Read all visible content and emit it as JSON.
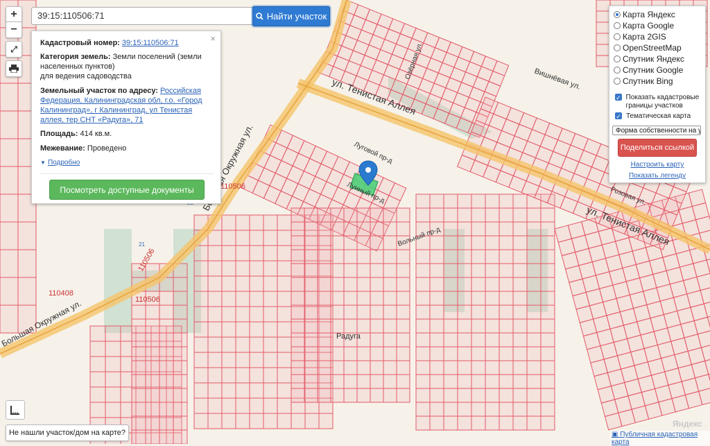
{
  "search": {
    "value": "39:15:110506:71",
    "button_label": "Найти участок"
  },
  "zoom": {
    "in": "+",
    "out": "−"
  },
  "info": {
    "cadastral_label": "Кадастровый номер:",
    "cadastral_value": "39:15:110506:71",
    "category_label": "Категория земель:",
    "category_value": "Земли поселений (земли населенных пунктов)",
    "category_use": "для ведения садоводства",
    "address_label": "Земельный участок по адресу:",
    "address_value": "Российская Федерация, Калининградская обл, г.о. «Город Калининград», г Калининград, ул Тенистая аллея, тер СНТ «Радуга», 71",
    "area_label": "Площадь:",
    "area_value": "414 кв.м.",
    "survey_label": "Межевание:",
    "survey_value": "Проведено",
    "details_link": "Подробно",
    "docs_button": "Посмотреть доступные документы",
    "close": "×"
  },
  "layers": {
    "options": [
      "Карта Яндекс",
      "Карта Google",
      "Карта 2GIS",
      "OpenStreetMap",
      "Спутник Яндекс",
      "Спутник Google",
      "Спутник Bing"
    ],
    "selected": "Карта Яндекс",
    "show_borders": "Показать кадастровые границы участков",
    "thematic": "Тематическая карта",
    "select_value": "Форма собственности на у",
    "share": "Поделиться ссылкой",
    "configure": "Настроить карту",
    "legend": "Показать легенду"
  },
  "bottom_button": "Не нашли участок/дом на карте?",
  "attribution": "Публичная кадастровая карта",
  "map_brand": "Яндекс",
  "map_labels": {
    "street_tenistaya": "ул. Тенистая Аллея",
    "street_tenistaya_2": "ул. Тенистая Аллея",
    "street_okruzhnaya": "Большая Окружная ул.",
    "street_okruzhnaya_2": "Большая Окружная ул.",
    "street_vishnevaya": "Вишнёвая ул.",
    "street_rozovaya": "Розовая ул.",
    "lane_1": "Луговой пр-д",
    "lane_2": "Лунный пр-д",
    "lane_3": "Вольный пр-д",
    "snt": "Радуга",
    "quarter_1": "110506",
    "quarter_2": "110506",
    "quarter_3": "110408",
    "quarter_4": "110506",
    "road_21": "21",
    "road_21b": "21",
    "lane_4": "Озёрная ул."
  },
  "colors": {
    "parcel": "#e35b68",
    "parcel_fill": "rgba(240,180,185,0.25)",
    "selected": "#4ed07a",
    "road": "#f5b342",
    "pin": "#2a7bcf"
  }
}
